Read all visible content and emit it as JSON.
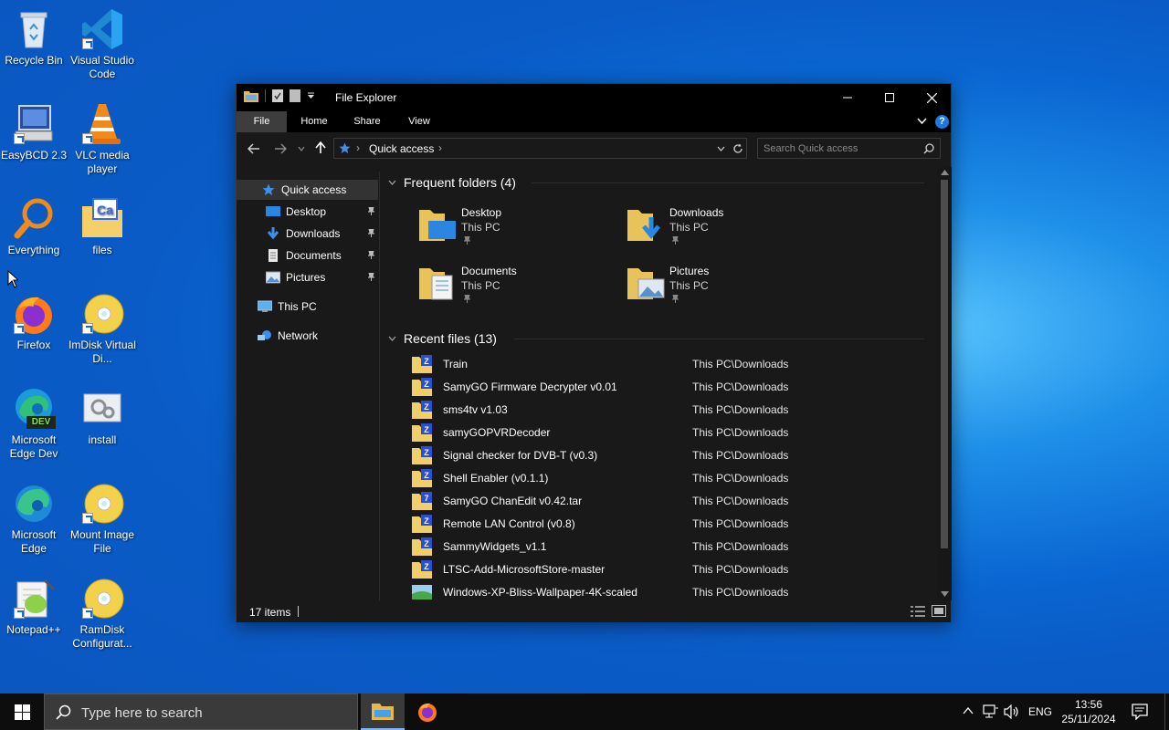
{
  "desktop": {
    "icons": [
      {
        "label": "Recycle Bin"
      },
      {
        "label": "Visual Studio Code"
      },
      {
        "label": "EasyBCD 2.3"
      },
      {
        "label": "VLC media player"
      },
      {
        "label": "Everything"
      },
      {
        "label": "files"
      },
      {
        "label": "Firefox"
      },
      {
        "label": "ImDisk Virtual Di..."
      },
      {
        "label": "Microsoft Edge Dev"
      },
      {
        "label": "install"
      },
      {
        "label": "Microsoft Edge"
      },
      {
        "label": "Mount Image File"
      },
      {
        "label": "Notepad++"
      },
      {
        "label": "RamDisk Configurat..."
      }
    ],
    "edge_dev_badge": "DEV"
  },
  "explorer": {
    "title": "File Explorer",
    "ribbon_tabs": [
      "File",
      "Home",
      "Share",
      "View"
    ],
    "help_label": "?",
    "address": {
      "crumb": "Quick access"
    },
    "search": {
      "placeholder": "Search Quick access"
    },
    "nav": {
      "quick_access": "Quick access",
      "pinned": [
        "Desktop",
        "Downloads",
        "Documents",
        "Pictures"
      ],
      "this_pc": "This PC",
      "network": "Network"
    },
    "frequent_header": "Frequent folders (4)",
    "frequent": [
      {
        "name": "Desktop",
        "location": "This PC"
      },
      {
        "name": "Downloads",
        "location": "This PC"
      },
      {
        "name": "Documents",
        "location": "This PC"
      },
      {
        "name": "Pictures",
        "location": "This PC"
      }
    ],
    "recent_header": "Recent files (13)",
    "recent": [
      {
        "name": "Train",
        "path": "This PC\\Downloads"
      },
      {
        "name": "SamyGO Firmware Decrypter v0.01",
        "path": "This PC\\Downloads"
      },
      {
        "name": "sms4tv v1.03",
        "path": "This PC\\Downloads"
      },
      {
        "name": "samyGOPVRDecoder",
        "path": "This PC\\Downloads"
      },
      {
        "name": "Signal checker for DVB-T (v0.3)",
        "path": "This PC\\Downloads"
      },
      {
        "name": "Shell Enabler (v0.1.1)",
        "path": "This PC\\Downloads"
      },
      {
        "name": "SamyGO ChanEdit v0.42.tar",
        "path": "This PC\\Downloads"
      },
      {
        "name": "Remote LAN Control (v0.8)",
        "path": "This PC\\Downloads"
      },
      {
        "name": "SammyWidgets_v1.1",
        "path": "This PC\\Downloads"
      },
      {
        "name": "LTSC-Add-MicrosoftStore-master",
        "path": "This PC\\Downloads"
      },
      {
        "name": "Windows-XP-Bliss-Wallpaper-4K-scaled",
        "path": "This PC\\Downloads"
      }
    ],
    "status": "17 items"
  },
  "taskbar": {
    "search_placeholder": "Type here to search",
    "language": "ENG",
    "time": "13:56",
    "date": "25/11/2024"
  }
}
